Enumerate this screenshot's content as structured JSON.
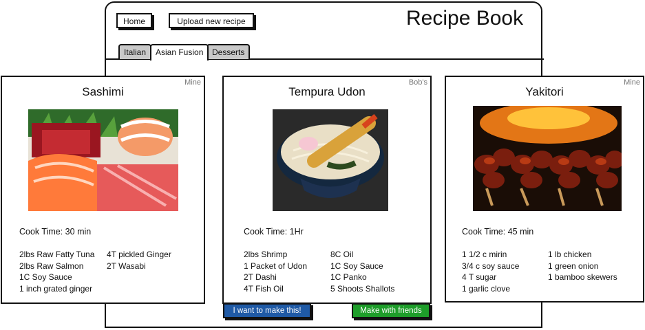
{
  "header": {
    "home_label": "Home",
    "upload_label": "Upload new recipe",
    "app_title": "Recipe Book"
  },
  "tabs": [
    {
      "label": "Italian"
    },
    {
      "label": "Asian Fusion",
      "active": true
    },
    {
      "label": "Desserts"
    }
  ],
  "recipes": [
    {
      "title": "Sashimi",
      "owner": "Mine",
      "cook_time": "Cook Time: 30 min",
      "ingredients_left": [
        "2lbs Raw Fatty Tuna",
        "2lbs Raw Salmon",
        "1C Soy Sauce",
        "1 inch grated ginger"
      ],
      "ingredients_right": [
        "4T pickled Ginger",
        "2T Wasabi"
      ]
    },
    {
      "title": "Tempura Udon",
      "owner": "Bob's",
      "cook_time": "Cook Time: 1Hr",
      "ingredients_left": [
        "2lbs Shrimp",
        "1 Packet of Udon",
        "2T Dashi",
        "4T Fish Oil"
      ],
      "ingredients_right": [
        "8C Oil",
        "1C Soy Sauce",
        "1C Panko",
        "5 Shoots Shallots"
      ]
    },
    {
      "title": "Yakitori",
      "owner": "Mine",
      "cook_time": "Cook Time: 45 min",
      "ingredients_left": [
        "1 1/2 c mirin",
        "3/4 c soy sauce",
        "4 T sugar",
        "1 garlic clove"
      ],
      "ingredients_right": [
        "1 lb chicken",
        "1 green onion",
        "1 bamboo skewers"
      ]
    }
  ],
  "actions": {
    "make_label": "I want to make this!",
    "make_color": "#1f5aa6",
    "friends_label": "Make with friends",
    "friends_color": "#1e9e2a"
  }
}
